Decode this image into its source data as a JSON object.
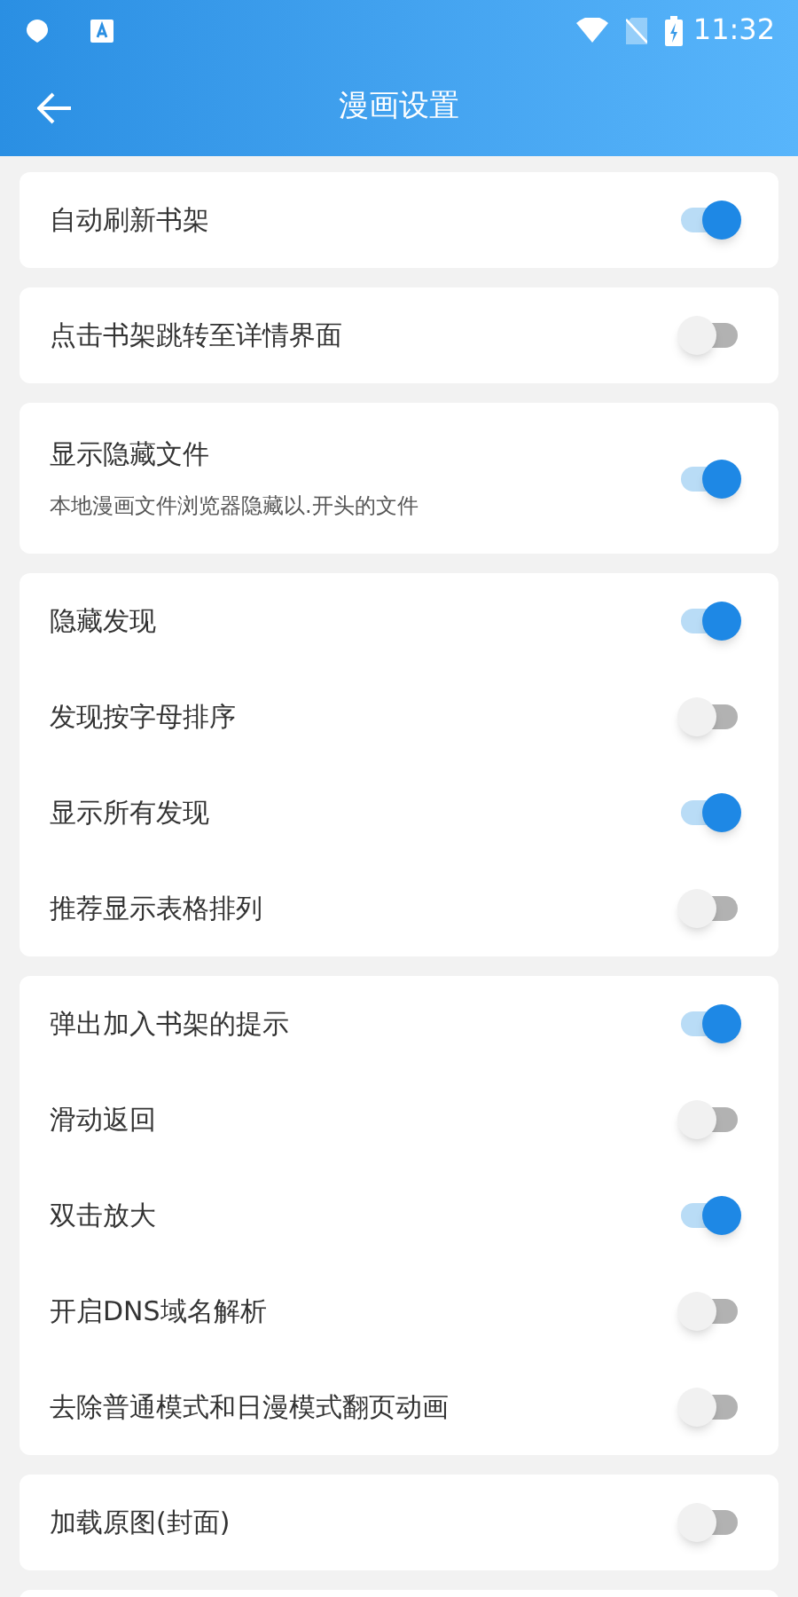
{
  "status_bar": {
    "time": "11:32"
  },
  "app_bar": {
    "title": "漫画设置"
  },
  "groups": [
    {
      "items": [
        {
          "title": "自动刷新书架",
          "on": true
        }
      ]
    },
    {
      "items": [
        {
          "title": "点击书架跳转至详情界面",
          "on": false
        }
      ]
    },
    {
      "items": [
        {
          "title": "显示隐藏文件",
          "subtitle": "本地漫画文件浏览器隐藏以.开头的文件",
          "on": true
        }
      ]
    },
    {
      "items": [
        {
          "title": "隐藏发现",
          "on": true
        },
        {
          "title": "发现按字母排序",
          "on": false
        },
        {
          "title": "显示所有发现",
          "on": true
        },
        {
          "title": "推荐显示表格排列",
          "on": false
        }
      ]
    },
    {
      "items": [
        {
          "title": "弹出加入书架的提示",
          "on": true
        },
        {
          "title": "滑动返回",
          "on": false
        },
        {
          "title": "双击放大",
          "on": true
        },
        {
          "title": "开启DNS域名解析",
          "on": false
        },
        {
          "title": "去除普通模式和日漫模式翻页动画",
          "on": false
        }
      ]
    },
    {
      "items": [
        {
          "title": "加载原图(封面)",
          "on": false
        }
      ]
    }
  ]
}
